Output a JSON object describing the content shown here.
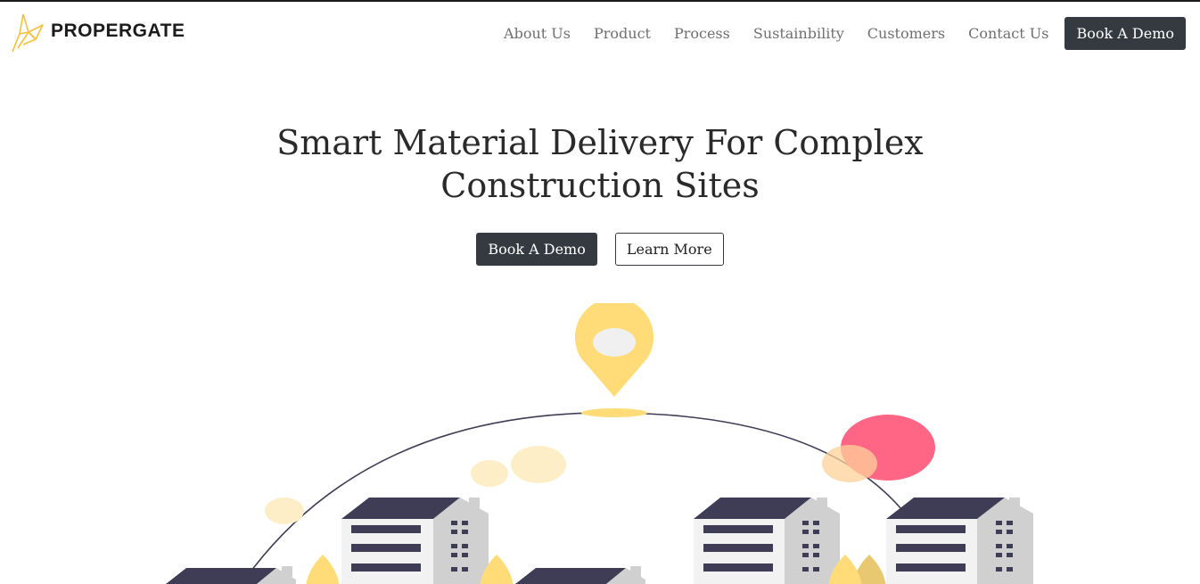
{
  "brand": {
    "name": "PROPERGATE",
    "logo_icon": "crane-origami-icon",
    "accent": "#f5c13a"
  },
  "nav": {
    "links": [
      "About Us",
      "Product",
      "Process",
      "Sustainbility",
      "Customers",
      "Contact Us"
    ],
    "cta": "Book A Demo"
  },
  "hero": {
    "title_line1": "Smart Material Delivery For Complex",
    "title_line2": "Construction Sites",
    "primary_button": "Book A Demo",
    "secondary_button": "Learn More"
  },
  "illustration": {
    "icons": [
      "location-pin-icon",
      "building-icon",
      "tree-icon",
      "cloud-icon"
    ],
    "colors": {
      "pin": "#ffdc78",
      "roof": "#3f3d56",
      "wall": "#f2f2f2",
      "side": "#d0d0d0",
      "accent": "#ff6584",
      "cloud": "#fdeec8"
    }
  }
}
